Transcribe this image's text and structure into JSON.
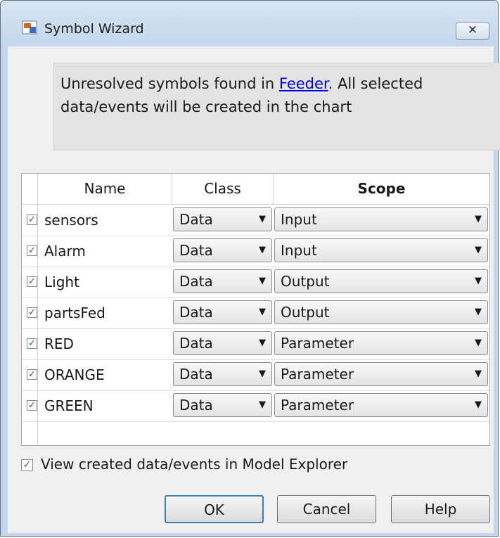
{
  "window": {
    "title": "Symbol Wizard",
    "close_glyph": "✕"
  },
  "info": {
    "prefix": "Unresolved symbols found in ",
    "link": "Feeder",
    "suffix": ". All selected data/events will be created in the chart"
  },
  "table": {
    "headers": {
      "name": "Name",
      "class": "Class",
      "scope": "Scope"
    },
    "rows": [
      {
        "checked": true,
        "name": "sensors",
        "class": "Data",
        "scope": "Input"
      },
      {
        "checked": true,
        "name": "Alarm",
        "class": "Data",
        "scope": "Input"
      },
      {
        "checked": true,
        "name": "Light",
        "class": "Data",
        "scope": "Output"
      },
      {
        "checked": true,
        "name": "partsFed",
        "class": "Data",
        "scope": "Output"
      },
      {
        "checked": true,
        "name": "RED",
        "class": "Data",
        "scope": "Parameter"
      },
      {
        "checked": true,
        "name": "ORANGE",
        "class": "Data",
        "scope": "Parameter"
      },
      {
        "checked": true,
        "name": "GREEN",
        "class": "Data",
        "scope": "Parameter"
      }
    ]
  },
  "footer": {
    "view_label": "View created data/events in Model Explorer",
    "view_checked": true
  },
  "buttons": {
    "ok": "OK",
    "cancel": "Cancel",
    "help": "Help"
  },
  "colors": {
    "link": "#0000ee",
    "check": "#2a56a8"
  },
  "icons": {
    "app": "symbol-wizard-app-icon",
    "checkmark": "✓",
    "dropdown": "▼"
  }
}
